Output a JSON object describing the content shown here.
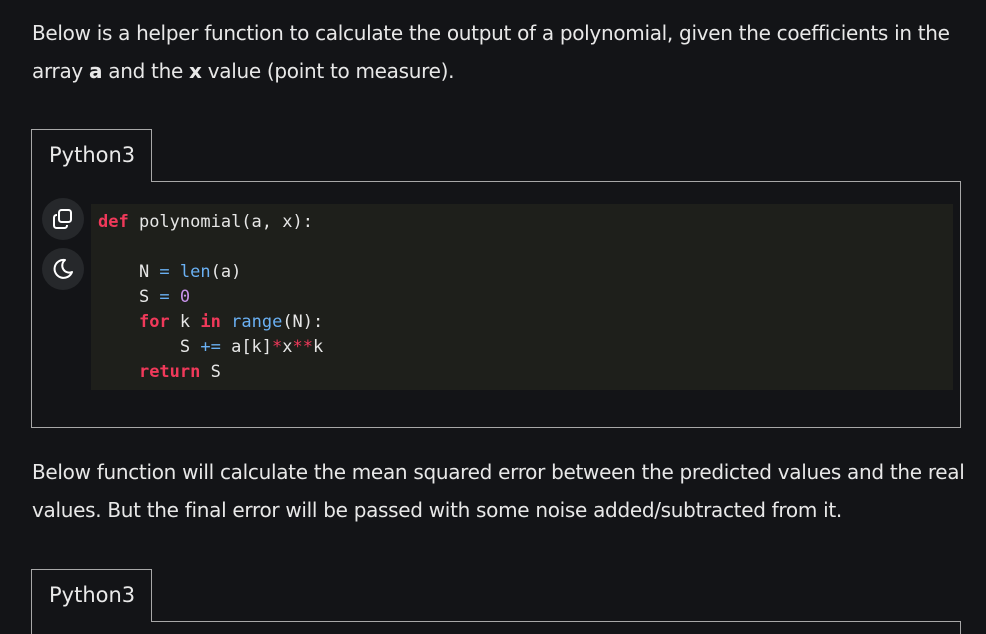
{
  "para1": {
    "t1": "Below is a helper function to calculate the output of a polynomial, given the coefficients in the array ",
    "a": "a",
    "t2": " and the ",
    "x": "x",
    "t3": " value (point to measure)."
  },
  "para2": "Below function will calculate the mean squared error between the predicted values and the real values. But the final error will be passed with some noise added/subtracted from it.",
  "tabs": [
    "Python3",
    "Python3"
  ],
  "code": {
    "l1_def": "def",
    "l1_rest": " polynomial(a, x):",
    "l3_a": "    N ",
    "l3_eq": "=",
    "l3_sp": " ",
    "l3_fn": "len",
    "l3_args": "(a)",
    "l4_a": "    S ",
    "l4_eq": "=",
    "l4_sp": " ",
    "l4_num": "0",
    "l5_for": "for",
    "l5_mid": " k ",
    "l5_in": "in",
    "l5_sp": " ",
    "l5_fn": "range",
    "l5_args": "(N):",
    "l6_a": "        S ",
    "l6_op": "+=",
    "l6_b": " a[k]",
    "l6_s1": "*",
    "l6_c": "x",
    "l6_s2": "**",
    "l6_d": "k",
    "l7_ret": "return",
    "l7_rest": " S"
  },
  "icons": {
    "copy": "copy-icon",
    "theme": "moon-icon"
  }
}
